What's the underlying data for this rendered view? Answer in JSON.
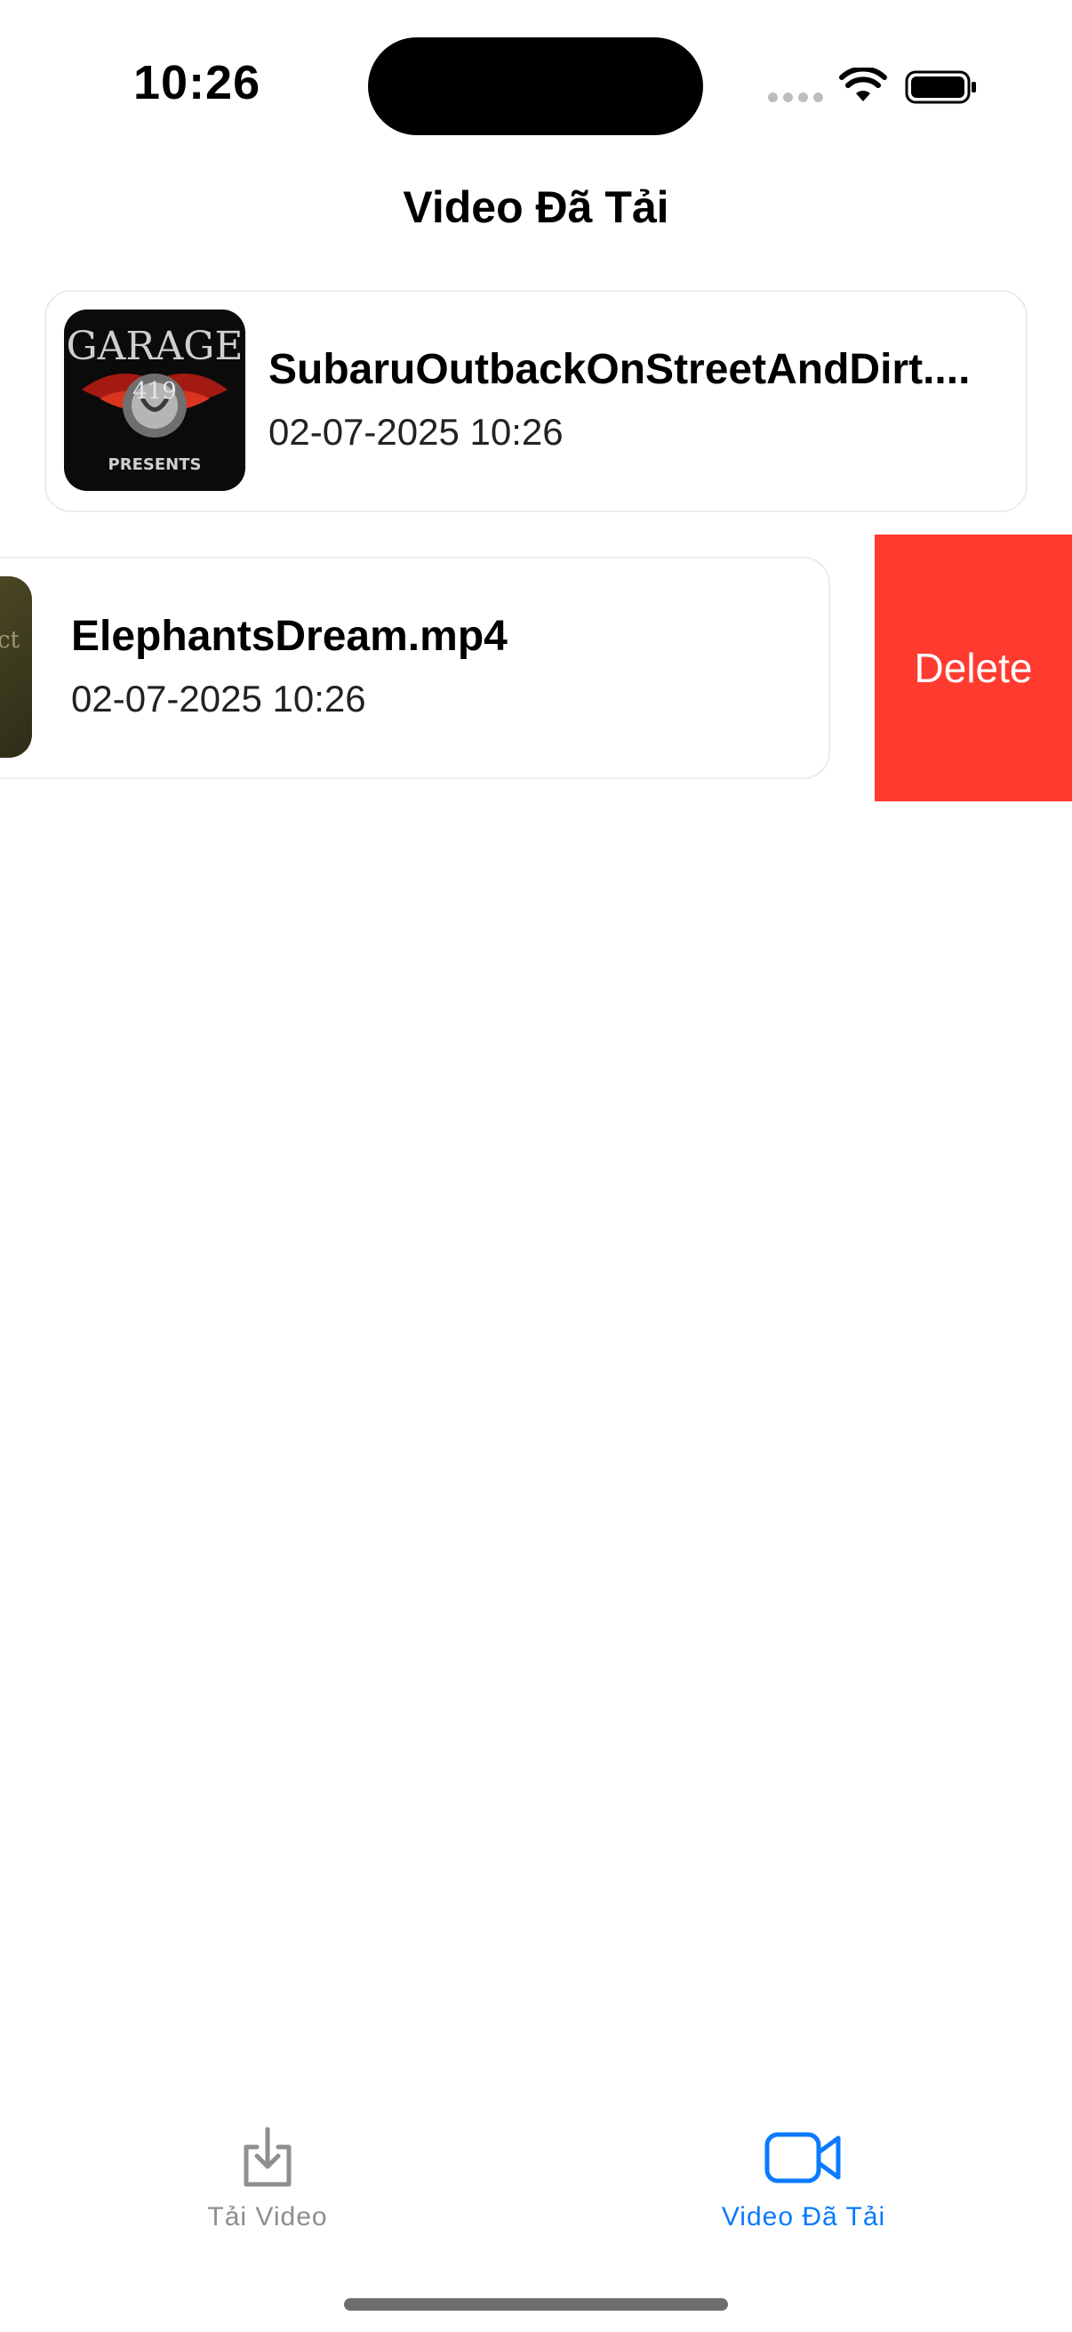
{
  "status_bar": {
    "time": "10:26"
  },
  "nav": {
    "title": "Video Đã Tải"
  },
  "videos": [
    {
      "title": "SubaruOutbackOnStreetAndDirt....",
      "date": "02-07-2025 10:26",
      "thumbnail_text": [
        "GARAGE",
        "419",
        "PRESENTS"
      ]
    },
    {
      "title": "ElephantsDream.mp4",
      "date": "02-07-2025 10:26",
      "thumbnail_text": [
        "project"
      ]
    }
  ],
  "swipe_action": {
    "label": "Delete",
    "color": "#ff3b30"
  },
  "tab_bar": {
    "tabs": [
      {
        "label": "Tải Video",
        "icon": "download-tray-icon",
        "selected": false
      },
      {
        "label": "Video Đã Tải",
        "icon": "video-camera-icon",
        "selected": true
      }
    ],
    "accent_color": "#0a7aff",
    "inactive_color": "#8e8e93"
  }
}
